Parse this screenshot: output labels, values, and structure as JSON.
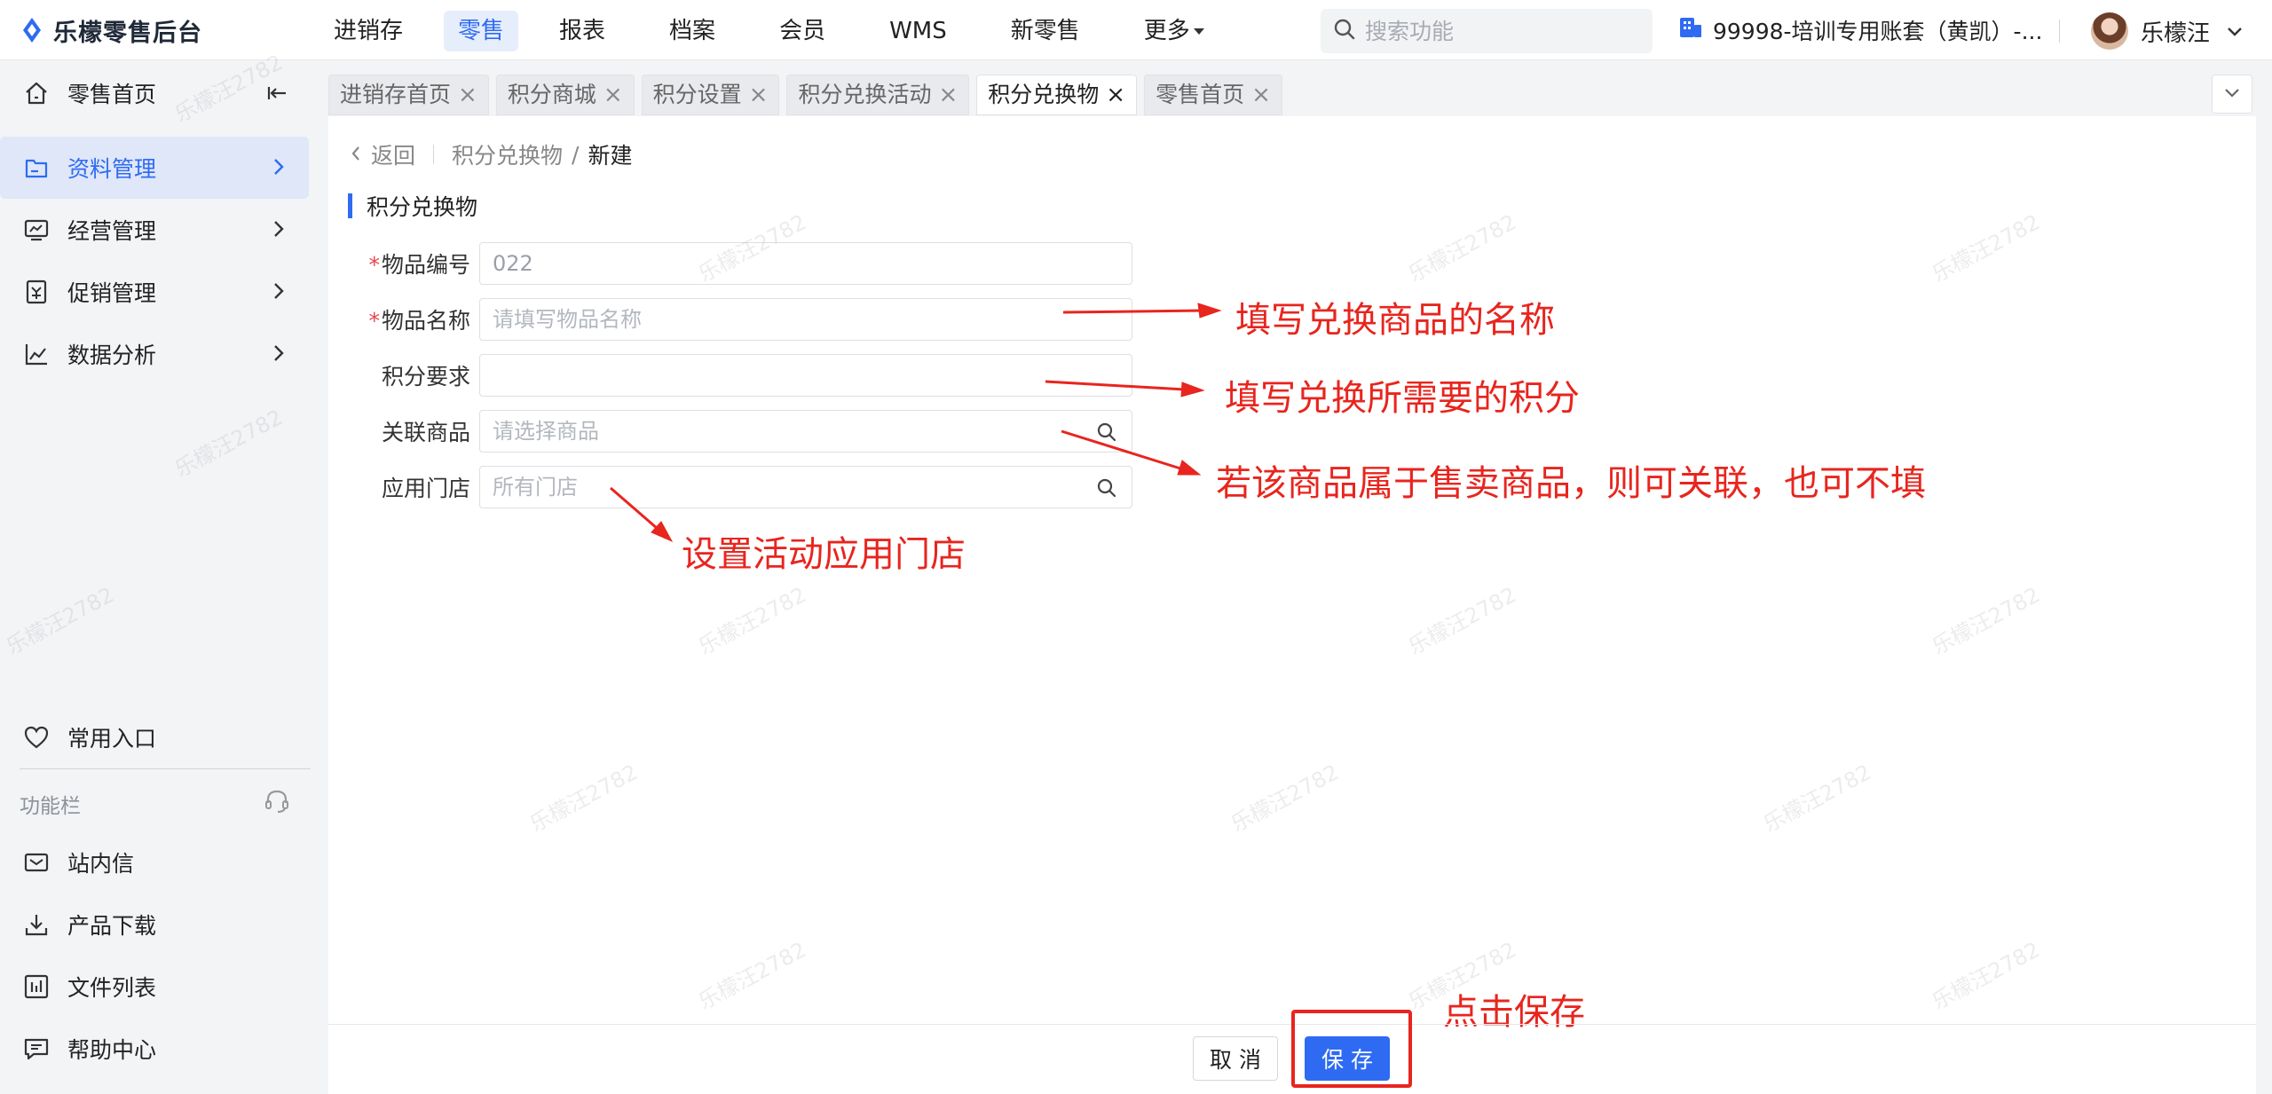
{
  "app": {
    "title": "乐檬零售后台"
  },
  "topnav": [
    {
      "label": "进销存",
      "active": false
    },
    {
      "label": "零售",
      "active": true
    },
    {
      "label": "报表",
      "active": false
    },
    {
      "label": "档案",
      "active": false
    },
    {
      "label": "会员",
      "active": false
    },
    {
      "label": "WMS",
      "active": false
    },
    {
      "label": "新零售",
      "active": false
    },
    {
      "label": "更多",
      "active": false
    }
  ],
  "search": {
    "placeholder": "搜索功能"
  },
  "account": {
    "label": "99998-培训专用账套（黄凯）-..."
  },
  "user": {
    "name": "乐檬汪"
  },
  "sidebar": {
    "items": [
      {
        "label": "零售首页",
        "icon": "home-icon"
      },
      {
        "label": "资料管理",
        "icon": "folder-icon"
      },
      {
        "label": "经营管理",
        "icon": "monitor-icon"
      },
      {
        "label": "促销管理",
        "icon": "promo-icon"
      },
      {
        "label": "数据分析",
        "icon": "chart-line-icon"
      }
    ],
    "favorites": "常用入口",
    "section_label": "功能栏",
    "tools": [
      {
        "label": "站内信",
        "icon": "mail-icon"
      },
      {
        "label": "产品下载",
        "icon": "download-icon"
      },
      {
        "label": "文件列表",
        "icon": "file-list-icon"
      },
      {
        "label": "帮助中心",
        "icon": "help-icon"
      }
    ]
  },
  "tabs": [
    {
      "label": "进销存首页",
      "active": false
    },
    {
      "label": "积分商城",
      "active": false
    },
    {
      "label": "积分设置",
      "active": false
    },
    {
      "label": "积分兑换活动",
      "active": false
    },
    {
      "label": "积分兑换物",
      "active": true
    },
    {
      "label": "零售首页",
      "active": false
    }
  ],
  "breadcrumb": {
    "back": "返回",
    "parent": "积分兑换物",
    "separator": "/",
    "current": "新建"
  },
  "section_title": "积分兑换物",
  "form": {
    "fields": [
      {
        "label": "物品编号",
        "required": true,
        "value": "022",
        "placeholder": ""
      },
      {
        "label": "物品名称",
        "required": true,
        "value": "",
        "placeholder": "请填写物品名称"
      },
      {
        "label": "积分要求",
        "required": false,
        "value": "",
        "placeholder": ""
      },
      {
        "label": "关联商品",
        "required": false,
        "value": "",
        "placeholder": "请选择商品"
      },
      {
        "label": "应用门店",
        "required": false,
        "value": "",
        "placeholder": "所有门店"
      }
    ],
    "required_mark": "*"
  },
  "annotations": {
    "name": "填写兑换商品的名称",
    "points": "填写兑换所需要的积分",
    "product": "若该商品属于售卖商品，则可关联，也可不填",
    "store": "设置活动应用门店",
    "save": "点击保存"
  },
  "footer": {
    "cancel": "取 消",
    "save": "保 存"
  },
  "watermark": "乐檬汪2782",
  "colors": {
    "accent": "#2f6bf2",
    "annotation": "#e8251e",
    "required": "#e5484d"
  }
}
